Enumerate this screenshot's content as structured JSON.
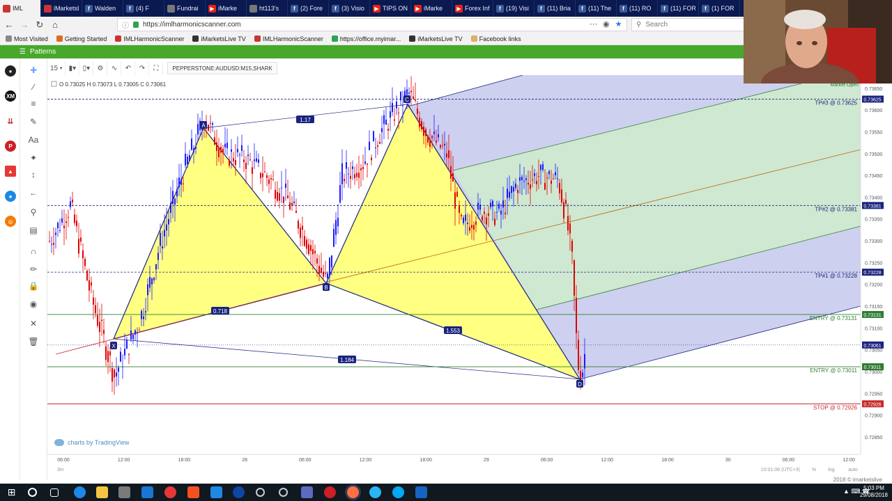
{
  "browser": {
    "tabs": [
      {
        "label": "IML",
        "icon": "im",
        "active": true
      },
      {
        "label": "iMarketsLive",
        "icon": "im"
      },
      {
        "label": "Walden",
        "icon": "fb"
      },
      {
        "label": "(4) F",
        "icon": "fb"
      },
      {
        "label": "Fundrai",
        "icon": "gen"
      },
      {
        "label": "iMarke",
        "icon": "yt"
      },
      {
        "label": "ht113's",
        "icon": "gen"
      },
      {
        "label": "(2) Fore",
        "icon": "fb"
      },
      {
        "label": "(3) Visio",
        "icon": "fb"
      },
      {
        "label": "TIPS ON",
        "icon": "yt"
      },
      {
        "label": "iMarke",
        "icon": "yt"
      },
      {
        "label": "Forex Inf",
        "icon": "yt"
      },
      {
        "label": "(19) Visi",
        "icon": "fb"
      },
      {
        "label": "(11) Bria",
        "icon": "fb"
      },
      {
        "label": "(11) The",
        "icon": "fb"
      },
      {
        "label": "(11) RO",
        "icon": "fb"
      },
      {
        "label": "(11) FOR",
        "icon": "fb"
      },
      {
        "label": "(1) FOR",
        "icon": "fb"
      }
    ],
    "url": "https://imlharmonicscanner.com",
    "search_placeholder": "Search",
    "bookmarks": [
      {
        "label": "Most Visited",
        "color": "#888888"
      },
      {
        "label": "Getting Started",
        "color": "#e06b1f"
      },
      {
        "label": "IMLHarmonicScanner",
        "color": "#cc3333"
      },
      {
        "label": "iMarketsLive TV",
        "color": "#333333"
      },
      {
        "label": "IMLHarmonicScanner",
        "color": "#cc3333"
      },
      {
        "label": "https://office.myimar...",
        "color": "#2ea44f"
      },
      {
        "label": "iMarketsLive TV",
        "color": "#333333"
      },
      {
        "label": "Facebook links",
        "color": "#d9b16a"
      }
    ]
  },
  "app": {
    "pattern_menu_label": "Patterns",
    "timeframe": "15",
    "symbol": "PEPPERSTONE:AUDUSD:M15,SHARK",
    "ohlc": "O 0.73025  H 0.73073  L 0.73005  C 0.73061",
    "market_status": "Market Open",
    "watermark": "charts by TradingView",
    "copyright": "2018 © imarketslive",
    "bottom_right": "10:01:08 (UTC+3)",
    "bottom_toggles": [
      "%",
      "log",
      "auto"
    ],
    "bottom_left_label": "3m"
  },
  "chart_data": {
    "type": "line",
    "title": "PEPPERSTONE:AUDUSD:M15,SHARK",
    "pattern": "Shark",
    "points": [
      {
        "label": "X",
        "time": "27 12:00",
        "price": 0.7299
      },
      {
        "label": "A",
        "time": "27 18:00",
        "price": 0.7358
      },
      {
        "label": "B",
        "time": "28 06:00",
        "price": 0.732
      },
      {
        "label": "C",
        "time": "28 18:00",
        "price": 0.7364
      },
      {
        "label": "D",
        "time": "29 08:45",
        "price": 0.72985
      }
    ],
    "ratios": [
      {
        "label": "1.17"
      },
      {
        "label": "0.718"
      },
      {
        "label": "1.553"
      },
      {
        "label": "1.184"
      }
    ],
    "levels": [
      {
        "label": "TP#3 @ 0.73625",
        "price": 0.73625,
        "color": "#1a237e",
        "tag": "0.73625"
      },
      {
        "label": "TP#2 @ 0.73381",
        "price": 0.73381,
        "color": "#1a237e",
        "tag": "0.73381"
      },
      {
        "label": "TP#1 @ 0.73228",
        "price": 0.73228,
        "color": "#1a237e",
        "tag": "0.73228"
      },
      {
        "label": "ENTRY @ 0.73131",
        "price": 0.73131,
        "color": "#2e7d32",
        "tag": "0.73131"
      },
      {
        "label": "ENTRY @ 0.73011",
        "price": 0.73011,
        "color": "#2e7d32",
        "tag": "0.73011"
      },
      {
        "label": "STOP @ 0.72926",
        "price": 0.72926,
        "color": "#c62828",
        "tag": "0.72926"
      }
    ],
    "current_price": {
      "price": 0.73061,
      "tag": "0.73061"
    },
    "y_ticks": [
      "0.73650",
      "0.73600",
      "0.73550",
      "0.73500",
      "0.73450",
      "0.73400",
      "0.73350",
      "0.73300",
      "0.73250",
      "0.73200",
      "0.73150",
      "0.73100",
      "0.73050",
      "0.73000",
      "0.72950",
      "0.72900",
      "0.72850"
    ],
    "y_tick_values": [
      0.7365,
      0.736,
      0.7355,
      0.735,
      0.7345,
      0.734,
      0.7335,
      0.733,
      0.7325,
      0.732,
      0.7315,
      0.731,
      0.7305,
      0.73,
      0.7295,
      0.729,
      0.7285
    ],
    "x_ticks": [
      "06:00",
      "12:00",
      "18:00",
      "28",
      "06:00",
      "12:00",
      "18:00",
      "29",
      "06:00",
      "12:00",
      "18:00",
      "30",
      "06:00",
      "12:00"
    ],
    "ylim": [
      0.7281,
      0.7368
    ]
  },
  "taskbar": {
    "time": "5:03 PM",
    "date": "29/08/2018"
  }
}
